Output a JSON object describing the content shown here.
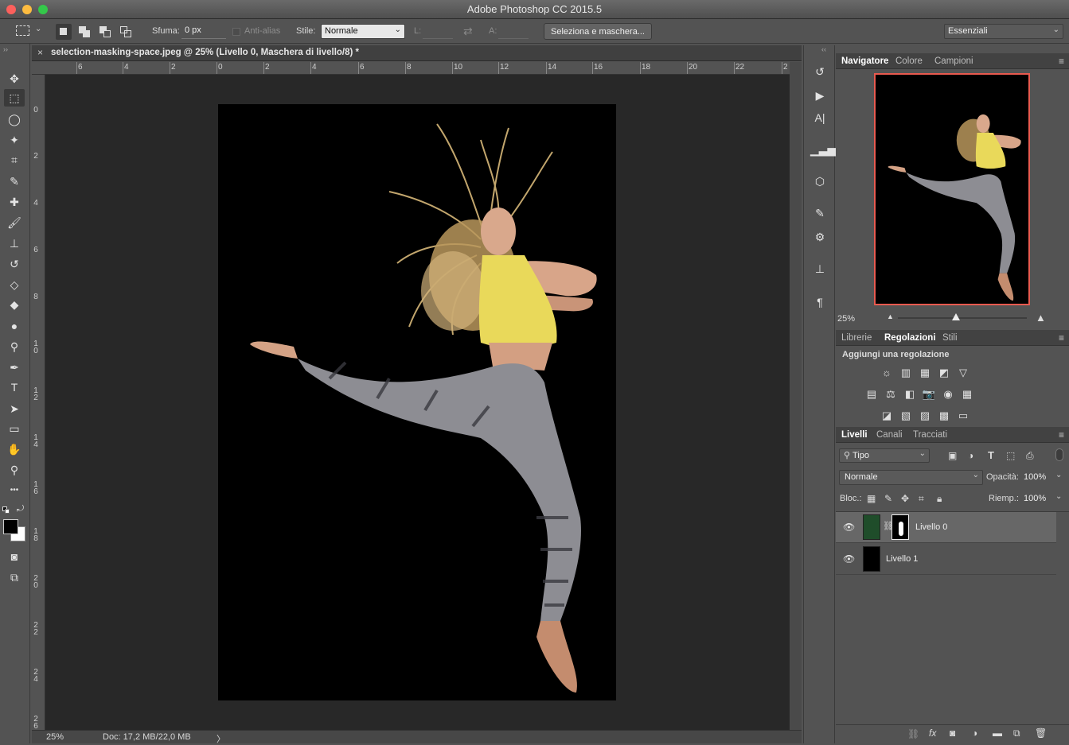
{
  "window": {
    "title": "Adobe Photoshop CC 2015.5"
  },
  "colors": {
    "close": "#fc605c",
    "minimize": "#fdbc40",
    "zoom": "#34c84a",
    "navigator_frame": "#e85a4f"
  },
  "options_bar": {
    "feather_label": "Sfuma:",
    "feather_value": "0 px",
    "antialias_label": "Anti-alias",
    "style_label": "Stile:",
    "style_value": "Normale",
    "width_label": "L:",
    "height_label": "A:",
    "select_mask_button": "Seleziona e maschera...",
    "workspace": "Essenziali"
  },
  "tools": [
    {
      "name": "move-tool",
      "icon": "✥"
    },
    {
      "name": "marquee-tool",
      "icon": "⬚"
    },
    {
      "name": "lasso-tool",
      "icon": "◯"
    },
    {
      "name": "magic-wand-tool",
      "icon": "✦"
    },
    {
      "name": "crop-tool",
      "icon": "⌗"
    },
    {
      "name": "eyedropper-tool",
      "icon": "✎"
    },
    {
      "name": "healing-brush-tool",
      "icon": "✚"
    },
    {
      "name": "brush-tool",
      "icon": "🖌"
    },
    {
      "name": "clone-stamp-tool",
      "icon": "⊥"
    },
    {
      "name": "history-brush-tool",
      "icon": "↺"
    },
    {
      "name": "eraser-tool",
      "icon": "◇"
    },
    {
      "name": "paint-bucket-tool",
      "icon": "◆"
    },
    {
      "name": "blur-tool",
      "icon": "●"
    },
    {
      "name": "dodge-tool",
      "icon": "⚲"
    },
    {
      "name": "pen-tool",
      "icon": "✒"
    },
    {
      "name": "type-tool",
      "icon": "T"
    },
    {
      "name": "path-selection-tool",
      "icon": "➤"
    },
    {
      "name": "rectangle-tool",
      "icon": "▭"
    },
    {
      "name": "hand-tool",
      "icon": "✋"
    },
    {
      "name": "zoom-tool",
      "icon": "⚲"
    },
    {
      "name": "more-tools",
      "icon": "•••"
    }
  ],
  "document": {
    "tab_title": "selection-masking-space.jpeg @ 25% (Livello 0, Maschera di livello/8) *",
    "ruler_top": [
      "6",
      "4",
      "2",
      "0",
      "2",
      "4",
      "6",
      "8",
      "10",
      "12",
      "14",
      "16",
      "18",
      "20",
      "22",
      "2"
    ],
    "ruler_left": [
      "0",
      "2",
      "4",
      "6",
      "8",
      "1 0",
      "1 2",
      "1 4",
      "1 6",
      "1 8",
      "2 0",
      "2 2",
      "2 4",
      "2 6"
    ],
    "zoom": "25%",
    "doc_info": "Doc: 17,2 MB/22,0 MB",
    "arrow": "〉"
  },
  "navigator": {
    "tabs": [
      "Navigatore",
      "Colore",
      "Campioni"
    ],
    "zoom": "25%",
    "zoom_fraction": 0.45
  },
  "adjustments": {
    "tabs": [
      "Librerie",
      "Regolazioni",
      "Stili"
    ],
    "heading": "Aggiungi una regolazione",
    "row1": [
      "☼",
      "▥",
      "▦",
      "◩",
      "▽"
    ],
    "row2": [
      "▤",
      "⚖",
      "◧",
      "📷",
      "◉",
      "▦"
    ],
    "row3": [
      "◪",
      "▧",
      "▨",
      "▩",
      "▭"
    ]
  },
  "layers": {
    "tabs": [
      "Livelli",
      "Canali",
      "Tracciati"
    ],
    "filter_kind": "Tipo",
    "blend_mode": "Normale",
    "opacity_label": "Opacità:",
    "opacity_value": "100%",
    "lock_label": "Bloc.:",
    "fill_label": "Riemp.:",
    "fill_value": "100%",
    "items": [
      {
        "name": "Livello 0",
        "selected": true
      },
      {
        "name": "Livello 1",
        "selected": false
      }
    ]
  }
}
